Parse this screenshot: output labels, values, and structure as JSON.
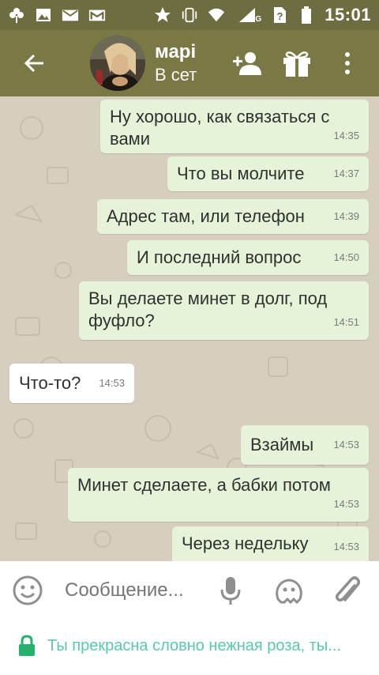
{
  "status_bar": {
    "icons_left": [
      "clover-icon",
      "image-icon",
      "mail-icon",
      "mail-m-icon"
    ],
    "icons_right": [
      "star-icon",
      "vibrate-icon",
      "wifi-icon",
      "signal-3g-icon",
      "sim-unknown-icon",
      "battery-icon"
    ],
    "network_label": "3G",
    "time": "15:01"
  },
  "chat_header": {
    "name": "марі",
    "status": "В сет",
    "actions": [
      "add-contact-icon",
      "gift-icon",
      "more-vert-icon"
    ]
  },
  "messages": [
    {
      "direction": "out",
      "text_line1": "Ну хорошо, как связаться с",
      "text_line2": "вами",
      "time": "14:35"
    },
    {
      "direction": "out",
      "text": "Что вы молчите",
      "time": "14:37"
    },
    {
      "direction": "out",
      "text": "Адрес там, или телефон",
      "time": "14:39"
    },
    {
      "direction": "out",
      "text": "И последний вопрос",
      "time": "14:50"
    },
    {
      "direction": "out",
      "text_line1": "Вы делаете минет в долг, под",
      "text_line2": "фуфло?",
      "time": "14:51"
    },
    {
      "direction": "in",
      "text": "Что-то?",
      "time": "14:53"
    },
    {
      "direction": "out",
      "text": "Взаймы",
      "time": "14:53"
    },
    {
      "direction": "out",
      "text": "Минет сделаете, а бабки потом",
      "time": "14:53"
    },
    {
      "direction": "out",
      "text": "Через недельку",
      "time": "14:53"
    }
  ],
  "composer": {
    "placeholder": "Сообщение...",
    "icons": [
      "smiley-icon",
      "microphone-icon",
      "sticker-icon",
      "paperclip-icon"
    ]
  },
  "security": {
    "text": "Ты прекрасна словно нежная роза, ты..."
  },
  "colors": {
    "status_bar": "#6e6c41",
    "app_bar": "#7a7845",
    "outgoing_bubble": "#e6f3d9",
    "incoming_bubble": "#ffffff",
    "chat_background": "#d6cebf",
    "security_text": "#57c9ad",
    "lock_green": "#24b26e"
  }
}
